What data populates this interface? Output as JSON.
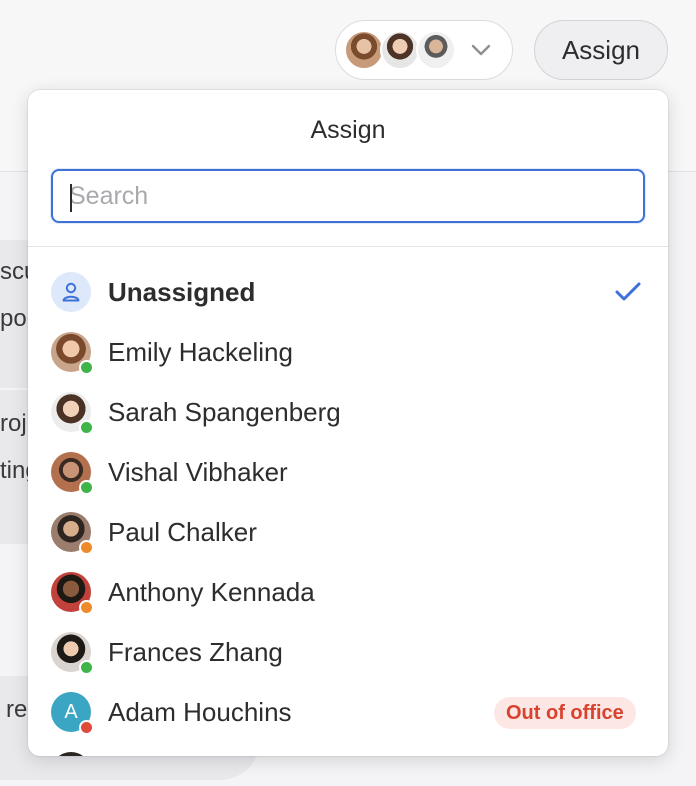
{
  "toolbar": {
    "assign_button_label": "Assign"
  },
  "background": {
    "snippets": [
      "scu",
      "po",
      "roj",
      "ting",
      "re"
    ]
  },
  "dropdown": {
    "title": "Assign",
    "search": {
      "value": "",
      "placeholder": "Search"
    },
    "items": [
      {
        "label": "Unassigned",
        "selected": true,
        "bold": true
      },
      {
        "label": "Emily Hackeling",
        "status": "online",
        "status_color": "#3fb449"
      },
      {
        "label": "Sarah Spangenberg",
        "status": "online",
        "status_color": "#3fb449"
      },
      {
        "label": "Vishal Vibhaker",
        "status": "online",
        "status_color": "#3fb449"
      },
      {
        "label": "Paul Chalker",
        "status": "away",
        "status_color": "#ef8a2a"
      },
      {
        "label": "Anthony Kennada",
        "status": "away",
        "status_color": "#ef8a2a"
      },
      {
        "label": "Frances Zhang",
        "status": "online",
        "status_color": "#3fb449"
      },
      {
        "label": "Adam Houchins",
        "status": "busy",
        "status_color": "#e04a3b",
        "avatar_letter": "A",
        "avatar_color": "#3aa6c4",
        "badge": "Out of office"
      }
    ]
  },
  "colors": {
    "accent": "#3d72d9",
    "badge_text": "#d8432f",
    "badge_bg": "#fde7e4"
  }
}
